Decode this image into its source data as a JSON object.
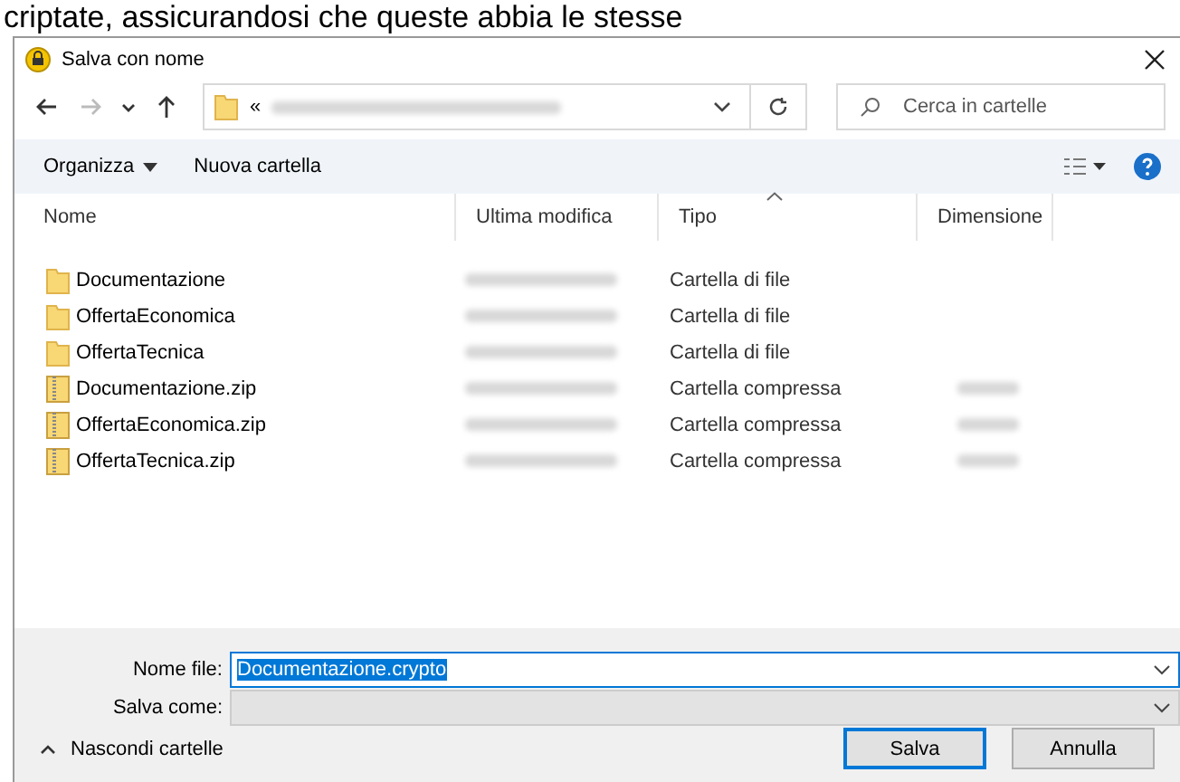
{
  "background_text": "criptate, assicurandosi che queste abbia le stesse",
  "window": {
    "title": "Salva con nome"
  },
  "nav": {
    "buttons": [
      {
        "kind": "back",
        "disabled": false
      },
      {
        "kind": "forward",
        "disabled": true
      },
      {
        "kind": "history",
        "disabled": false
      },
      {
        "kind": "up",
        "disabled": false
      }
    ],
    "address_prefix": "«",
    "search": {
      "placeholder": "Cerca in cartelle"
    }
  },
  "toolbar": {
    "items": [
      {
        "label": "Organizza",
        "kind": "menu"
      },
      {
        "label": "Nuova cartella",
        "kind": "button"
      }
    ]
  },
  "table": {
    "columns": [
      {
        "label": "Nome",
        "sorted": false
      },
      {
        "label": "Ultima modifica",
        "sorted": false
      },
      {
        "label": "Tipo",
        "sorted": true
      },
      {
        "label": "Dimensione",
        "sorted": false
      }
    ],
    "rows": [
      {
        "name": "Documentazione",
        "kind": "folder",
        "type": "Cartella di file"
      },
      {
        "name": "OffertaEconomica",
        "kind": "folder",
        "type": "Cartella di file"
      },
      {
        "name": "OffertaTecnica",
        "kind": "folder",
        "type": "Cartella di file"
      },
      {
        "name": "Documentazione.zip",
        "kind": "zip",
        "type": "Cartella compressa"
      },
      {
        "name": "OffertaEconomica.zip",
        "kind": "zip",
        "type": "Cartella compressa"
      },
      {
        "name": "OffertaTecnica.zip",
        "kind": "zip",
        "type": "Cartella compressa"
      }
    ]
  },
  "form": {
    "fields": [
      {
        "label": "Nome file:",
        "value": "Documentazione.crypto",
        "selected": true,
        "disabled": false
      },
      {
        "label": "Salva come:",
        "disabled": true
      }
    ]
  },
  "footer": {
    "toggle": "Nascondi cartelle",
    "buttons": [
      {
        "label": "Salva",
        "default": true
      },
      {
        "label": "Annulla",
        "default": false
      }
    ]
  }
}
